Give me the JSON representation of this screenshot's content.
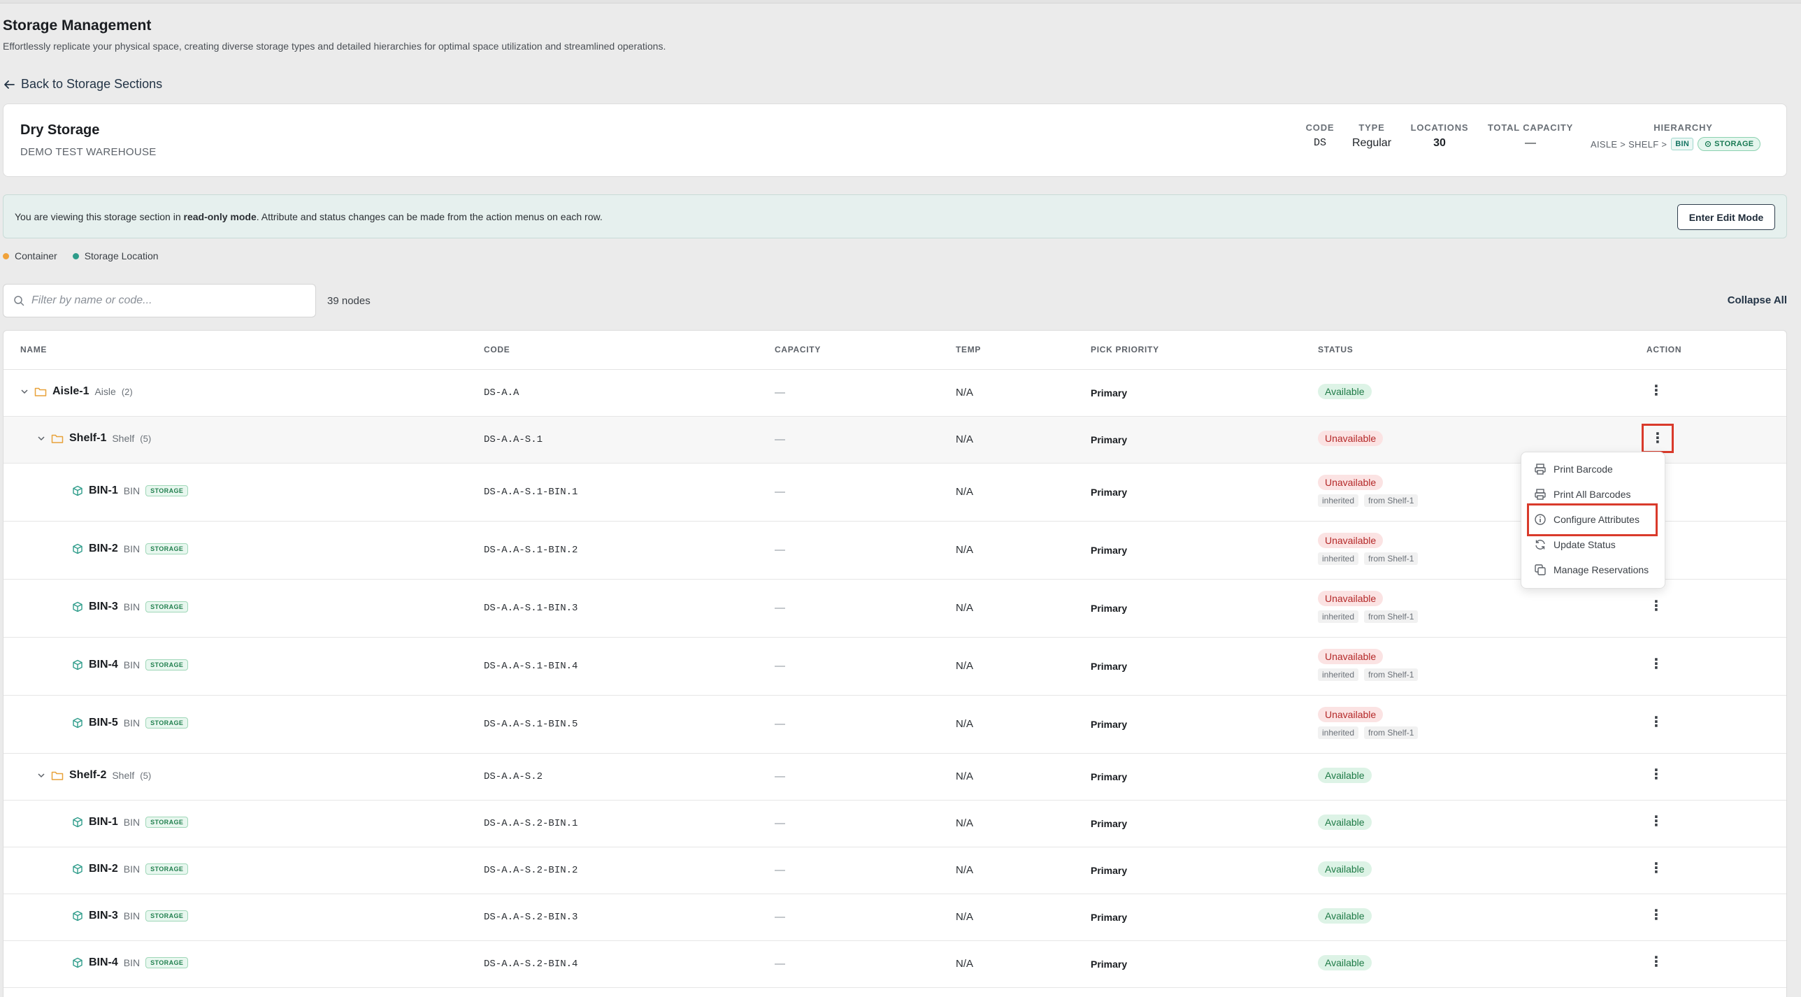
{
  "page": {
    "title": "Storage Management",
    "subtitle": "Effortlessly replicate your physical space, creating diverse storage types and detailed hierarchies for optimal space utilization and streamlined operations.",
    "back_label": "Back to Storage Sections"
  },
  "section": {
    "name": "Dry Storage",
    "warehouse": "DEMO TEST WAREHOUSE",
    "meta": {
      "code_label": "CODE",
      "code": "DS",
      "type_label": "TYPE",
      "type": "Regular",
      "locations_label": "LOCATIONS",
      "locations": "30",
      "capacity_label": "TOTAL CAPACITY",
      "capacity": "—",
      "hierarchy_label": "HIERARCHY",
      "hierarchy_path": "AISLE > SHELF >",
      "hierarchy_bin": "BIN",
      "hierarchy_storage": "STORAGE"
    }
  },
  "banner": {
    "text_before": "You are viewing this storage section in ",
    "text_bold": "read-only mode",
    "text_after": ". Attribute and status changes can be made from the action menus on each row.",
    "button": "Enter Edit Mode"
  },
  "legend": [
    {
      "label": "Container",
      "color": "#f0a23a"
    },
    {
      "label": "Storage Location",
      "color": "#2e9c8a"
    }
  ],
  "filter": {
    "placeholder": "Filter by name or code...",
    "value": ""
  },
  "node_count": "39 nodes",
  "collapse_all": "Collapse All",
  "table": {
    "headers": [
      "NAME",
      "CODE",
      "CAPACITY",
      "TEMP",
      "PICK PRIORITY",
      "STATUS",
      "ACTION"
    ],
    "rows": [
      {
        "name": "Aisle-1",
        "type": "Aisle",
        "count": "(2)",
        "code": "DS-A.A",
        "capacity": "—",
        "temp": "N/A",
        "priority": "Primary",
        "status": "Available",
        "tag": ""
      },
      {
        "name": "Shelf-1",
        "type": "Shelf",
        "count": "(5)",
        "code": "DS-A.A-S.1",
        "capacity": "—",
        "temp": "N/A",
        "priority": "Primary",
        "status": "Unavailable",
        "tag": ""
      },
      {
        "name": "BIN-1",
        "type": "BIN",
        "count": "",
        "code": "DS-A.A-S.1-BIN.1",
        "capacity": "—",
        "temp": "N/A",
        "priority": "Primary",
        "status": "Unavailable",
        "tag": "STORAGE",
        "inherited": "inherited",
        "from": "from Shelf-1"
      },
      {
        "name": "BIN-2",
        "type": "BIN",
        "count": "",
        "code": "DS-A.A-S.1-BIN.2",
        "capacity": "—",
        "temp": "N/A",
        "priority": "Primary",
        "status": "Unavailable",
        "tag": "STORAGE",
        "inherited": "inherited",
        "from": "from Shelf-1"
      },
      {
        "name": "BIN-3",
        "type": "BIN",
        "count": "",
        "code": "DS-A.A-S.1-BIN.3",
        "capacity": "—",
        "temp": "N/A",
        "priority": "Primary",
        "status": "Unavailable",
        "tag": "STORAGE",
        "inherited": "inherited",
        "from": "from Shelf-1"
      },
      {
        "name": "BIN-4",
        "type": "BIN",
        "count": "",
        "code": "DS-A.A-S.1-BIN.4",
        "capacity": "—",
        "temp": "N/A",
        "priority": "Primary",
        "status": "Unavailable",
        "tag": "STORAGE",
        "inherited": "inherited",
        "from": "from Shelf-1"
      },
      {
        "name": "BIN-5",
        "type": "BIN",
        "count": "",
        "code": "DS-A.A-S.1-BIN.5",
        "capacity": "—",
        "temp": "N/A",
        "priority": "Primary",
        "status": "Unavailable",
        "tag": "STORAGE",
        "inherited": "inherited",
        "from": "from Shelf-1"
      },
      {
        "name": "Shelf-2",
        "type": "Shelf",
        "count": "(5)",
        "code": "DS-A.A-S.2",
        "capacity": "—",
        "temp": "N/A",
        "priority": "Primary",
        "status": "Available",
        "tag": ""
      },
      {
        "name": "BIN-1",
        "type": "BIN",
        "count": "",
        "code": "DS-A.A-S.2-BIN.1",
        "capacity": "—",
        "temp": "N/A",
        "priority": "Primary",
        "status": "Available",
        "tag": "STORAGE"
      },
      {
        "name": "BIN-2",
        "type": "BIN",
        "count": "",
        "code": "DS-A.A-S.2-BIN.2",
        "capacity": "—",
        "temp": "N/A",
        "priority": "Primary",
        "status": "Available",
        "tag": "STORAGE"
      },
      {
        "name": "BIN-3",
        "type": "BIN",
        "count": "",
        "code": "DS-A.A-S.2-BIN.3",
        "capacity": "—",
        "temp": "N/A",
        "priority": "Primary",
        "status": "Available",
        "tag": "STORAGE"
      },
      {
        "name": "BIN-4",
        "type": "BIN",
        "count": "",
        "code": "DS-A.A-S.2-BIN.4",
        "capacity": "—",
        "temp": "N/A",
        "priority": "Primary",
        "status": "Available",
        "tag": "STORAGE"
      }
    ]
  },
  "action_menu": {
    "items": [
      "Print Barcode",
      "Print All Barcodes",
      "Configure Attributes",
      "Update Status",
      "Manage Reservations"
    ],
    "icons": [
      "printer-icon",
      "printer-icon",
      "info-icon",
      "refresh-icon",
      "copy-icon"
    ]
  },
  "colors": {
    "accent": "#233446",
    "available_bg": "#ddf3e6",
    "unavailable_bg": "#fbe3e3",
    "highlight": "#d93a2b"
  }
}
